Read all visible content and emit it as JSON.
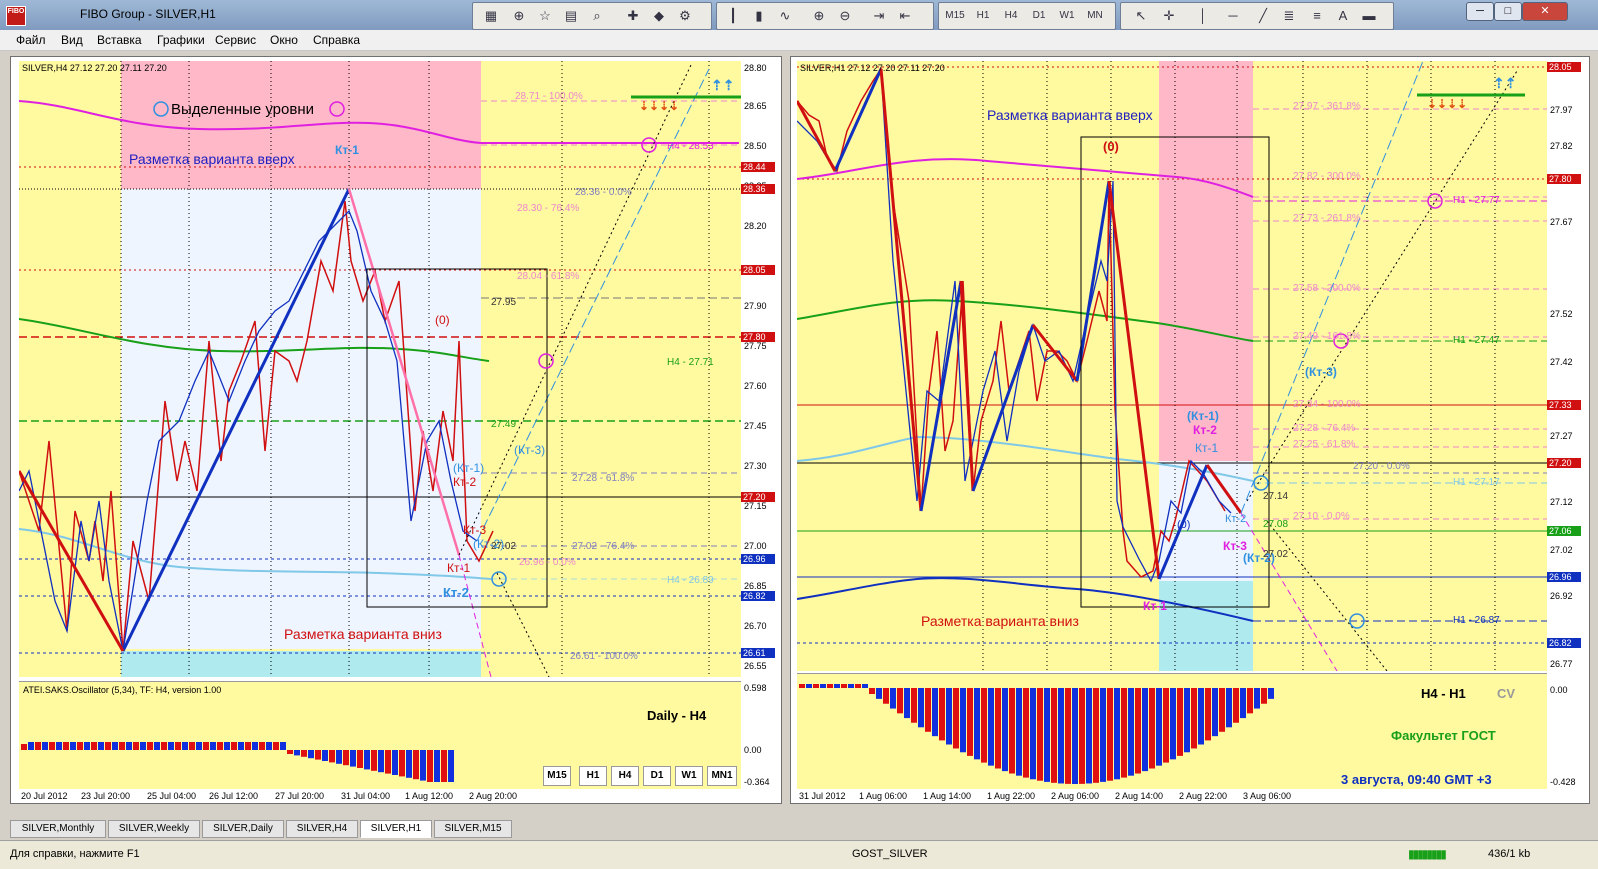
{
  "window": {
    "title": "FIBO Group - SILVER,H1",
    "logo": "FIBO"
  },
  "menu": [
    "Файл",
    "Вид",
    "Вставка",
    "Графики",
    "Сервис",
    "Окно",
    "Справка"
  ],
  "toolbar": {
    "timeframes": [
      "M15",
      "H1",
      "H4",
      "D1",
      "W1",
      "MN"
    ],
    "draw_tools": [
      "cursor-icon",
      "crosshair-icon",
      "vertical-line-icon",
      "horizontal-line-icon",
      "trendline-icon",
      "fibo-icon",
      "text-icon",
      "label-icon",
      "arrows-icon"
    ],
    "group1": [
      "new-chart-icon",
      "crosshair-icon",
      "favorites-icon",
      "navigator-icon",
      "zoom-icon",
      "new-order-icon",
      "alert-icon",
      "settings-icon"
    ],
    "group2": [
      "bar-chart-icon",
      "candles-icon",
      "line-chart-icon",
      "zoom-in-icon",
      "zoom-out-icon",
      "autoscroll-icon",
      "chart-shift-icon"
    ]
  },
  "left_chart": {
    "info": "SILVER,H4  27.12 27.20 27.11 27.20",
    "prices": [
      "28.80",
      "28.65",
      "28.50",
      "28.35",
      "28.20",
      "28.05",
      "27.90",
      "27.75",
      "27.60",
      "27.45",
      "27.30",
      "27.15",
      "27.00",
      "26.85",
      "26.70",
      "26.55"
    ],
    "tags": [
      {
        "text": "28.44",
        "color": "#d01010"
      },
      {
        "text": "28.36",
        "color": "#d01010"
      },
      {
        "text": "28.05",
        "color": "#d01010"
      },
      {
        "text": "27.80",
        "color": "#d01010"
      },
      {
        "text": "27.20",
        "color": "#d01010"
      },
      {
        "text": "26.96",
        "color": "#1030c0"
      },
      {
        "text": "26.82",
        "color": "#1030c0"
      },
      {
        "text": "26.61",
        "color": "#1030c0"
      }
    ],
    "labels": {
      "selected_levels": "Выделенные уровни",
      "up_variant": "Разметка варианта вверх",
      "down_variant": "Разметка варианта вниз",
      "kt1_top": "Кт-1",
      "zero": "(0)",
      "kt1_paren": "(Кт-1)",
      "kt2": "Кт-2",
      "kt3": "Кт-3",
      "kt1": "Кт-1",
      "kt2_paren": "(Кт-2)",
      "kt3_paren": "(Кт-3)",
      "kt2_blue": "Кт-2",
      "h4_2853": "H4 - 28.53",
      "h4_2771": "H4 - 27.71",
      "h4_2689": "H4 - 26.89",
      "val_2795": "27.95",
      "val_2749": "27.49",
      "val_2702": "27.02"
    },
    "fibo": [
      "28.71 - 100.0%",
      "28.36 - 0.0%",
      "28.30 - 76.4%",
      "28.04 - 61.8%",
      "27.28 - 61.8%",
      "27.02 - 76.4%",
      "26.96 - 0.0%",
      "26.61 - 100.0%"
    ],
    "osc": {
      "title": "ATEI.SAKS.Oscillator (5,34), TF: H4, version 1.00",
      "scale": [
        "0.598",
        "0.00",
        "-0.364"
      ],
      "caption": "Daily - H4"
    },
    "tf_buttons": [
      "M15",
      "H1",
      "H4",
      "D1",
      "W1",
      "MN1"
    ],
    "time": [
      "20 Jul 2012",
      "23 Jul 20:00",
      "25 Jul 04:00",
      "26 Jul 12:00",
      "27 Jul 20:00",
      "31 Jul 04:00",
      "1 Aug 12:00",
      "2 Aug 20:00"
    ]
  },
  "right_chart": {
    "info": "SILVER,H1  27.12 27.20 27.11 27.20",
    "prices": [
      "27.97",
      "27.82",
      "27.67",
      "27.52",
      "27.42",
      "27.27",
      "27.12",
      "27.02",
      "26.92",
      "26.77"
    ],
    "tags": [
      {
        "text": "28.05",
        "color": "#d01010"
      },
      {
        "text": "27.80",
        "color": "#d01010"
      },
      {
        "text": "27.33",
        "color": "#d01010"
      },
      {
        "text": "27.20",
        "color": "#d01010"
      },
      {
        "text": "27.06",
        "color": "#18a018"
      },
      {
        "text": "26.96",
        "color": "#1030c0"
      },
      {
        "text": "26.82",
        "color": "#1030c0"
      }
    ],
    "labels": {
      "up_variant": "Разметка варианта вверх",
      "down_variant": "Разметка варианта вниз",
      "zero": "(0)",
      "kt1_paren": "(Кт-1)",
      "kt2": "Кт-2",
      "kt1": "Кт-1",
      "kt3": "Кт-3",
      "kt2_small": "Кт-2",
      "kt3_paren": "(Кт-3)",
      "kt2_paren": "(Кт-2)",
      "kt1_bottom": "Кт-1",
      "zero_small": "(0)",
      "h1_2777": "H1 - 27.77",
      "h1_2747": "H1 - 27.47",
      "h1_2717": "H1 - 27.17",
      "h1_2687": "H1 - 26.87",
      "val_2714": "27.14",
      "val_2708": "27.08",
      "val_2702": "27.02"
    },
    "fibo": [
      "27.97 - 361.8%",
      "27.82 - 300.0%",
      "27.73 - 261.8%",
      "27.58 - 200.0%",
      "27.49 - 161.8%",
      "27.34 - 100.0%",
      "27.28 - 76.4%",
      "27.25 - 61.8%",
      "27.20 - 0.0%",
      "27.10 - 0.0%"
    ],
    "osc": {
      "scale": [
        "0.00",
        "-0.428"
      ],
      "caption": "H4 - H1",
      "cv": "CV",
      "faculty": "Факультет ГОСТ",
      "date": "3 августа, 09:40 GMT +3"
    },
    "time": [
      "31 Jul 2012",
      "1 Aug 06:00",
      "1 Aug 14:00",
      "1 Aug 22:00",
      "2 Aug 06:00",
      "2 Aug 14:00",
      "2 Aug 22:00",
      "3 Aug 06:00"
    ]
  },
  "tabs": [
    "SILVER,Monthly",
    "SILVER,Weekly",
    "SILVER,Daily",
    "SILVER,H4",
    "SILVER,H1",
    "SILVER,M15"
  ],
  "status": {
    "help": "Для справки, нажмите F1",
    "profile": "GOST_SILVER",
    "traffic": "436/1 kb"
  }
}
